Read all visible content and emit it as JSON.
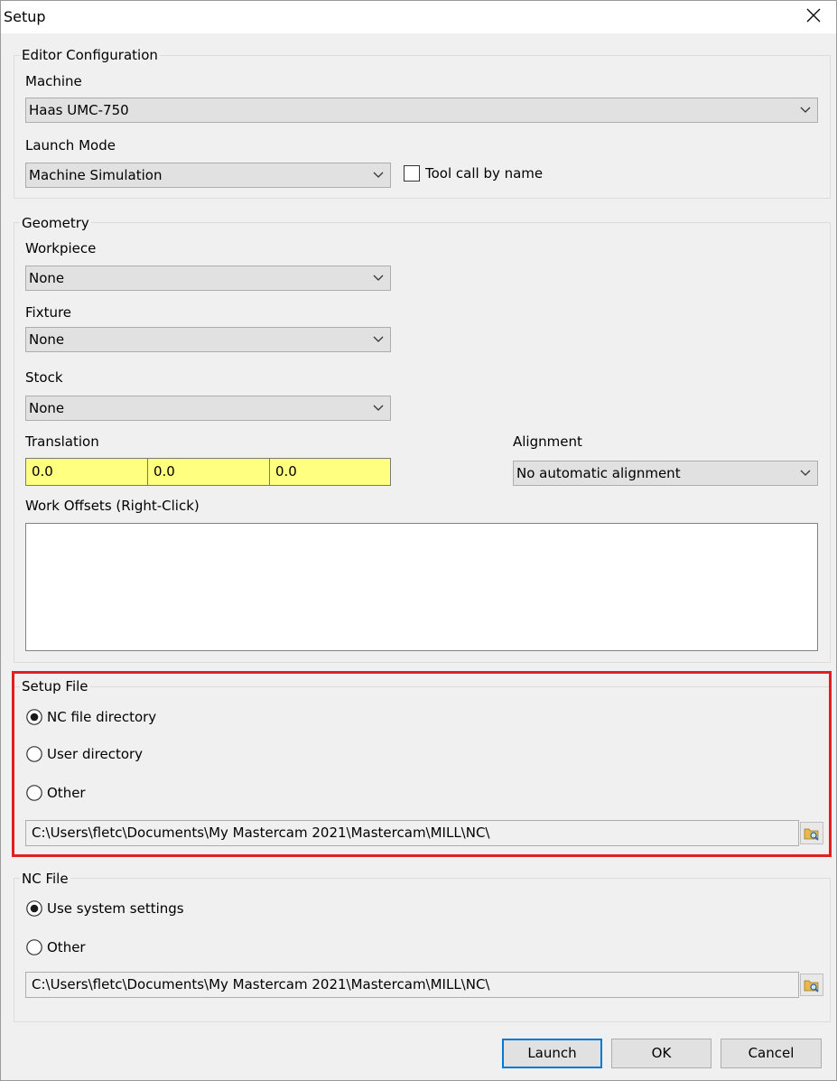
{
  "window": {
    "title": "Setup"
  },
  "editor_config": {
    "legend": "Editor Configuration",
    "machine_label": "Machine",
    "machine_value": "Haas UMC-750",
    "launch_mode_label": "Launch Mode",
    "launch_mode_value": "Machine Simulation",
    "tool_call_label": "Tool call by name"
  },
  "geometry": {
    "legend": "Geometry",
    "workpiece_label": "Workpiece",
    "workpiece_value": "None",
    "fixture_label": "Fixture",
    "fixture_value": "None",
    "stock_label": "Stock",
    "stock_value": "None",
    "translation_label": "Translation",
    "translation_x": "0.0",
    "translation_y": "0.0",
    "translation_z": "0.0",
    "alignment_label": "Alignment",
    "alignment_value": "No automatic alignment",
    "work_offsets_label": "Work Offsets (Right-Click)"
  },
  "setup_file": {
    "legend": "Setup File",
    "option_nc_dir": "NC file directory",
    "option_user_dir": "User directory",
    "option_other": "Other",
    "path": "C:\\Users\\fletc\\Documents\\My Mastercam 2021\\Mastercam\\MILL\\NC\\"
  },
  "nc_file": {
    "legend": "NC File",
    "option_system": "Use system settings",
    "option_other": "Other",
    "path": "C:\\Users\\fletc\\Documents\\My Mastercam 2021\\Mastercam\\MILL\\NC\\"
  },
  "buttons": {
    "launch": "Launch",
    "ok": "OK",
    "cancel": "Cancel"
  },
  "colors": {
    "highlight": "#e02020",
    "translation_bg": "#ffff80",
    "default_button_border": "#0078d7"
  }
}
